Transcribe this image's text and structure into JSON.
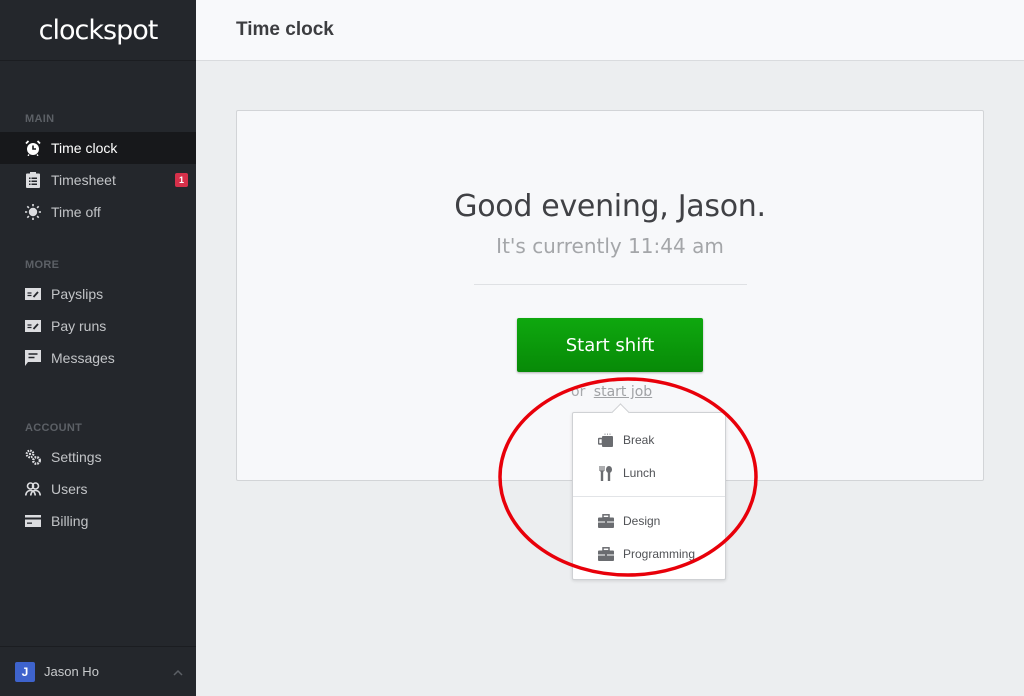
{
  "app": {
    "logo": "clockspot"
  },
  "sidebar": {
    "sections": [
      {
        "label": "MAIN",
        "items": [
          {
            "label": "Time clock",
            "icon": "alarm-clock-icon",
            "active": true
          },
          {
            "label": "Timesheet",
            "icon": "clipboard-list-icon",
            "badge": "1"
          },
          {
            "label": "Time off",
            "icon": "sun-icon"
          }
        ]
      },
      {
        "label": "MORE",
        "items": [
          {
            "label": "Payslips",
            "icon": "payslip-icon"
          },
          {
            "label": "Pay runs",
            "icon": "pay-run-icon"
          },
          {
            "label": "Messages",
            "icon": "chat-bubble-icon"
          }
        ]
      },
      {
        "label": "ACCOUNT",
        "items": [
          {
            "label": "Settings",
            "icon": "gears-icon"
          },
          {
            "label": "Users",
            "icon": "users-icon"
          },
          {
            "label": "Billing",
            "icon": "credit-card-icon"
          }
        ]
      }
    ],
    "user": {
      "initial": "J",
      "name": "Jason Ho",
      "avatar_color": "#3e63cc"
    }
  },
  "header": {
    "title": "Time clock"
  },
  "main": {
    "greeting": "Good evening, Jason.",
    "current_time": "It's currently 11:44 am",
    "start_shift_label": "Start shift",
    "or_text": "or",
    "start_job_label": "start job",
    "start_shift_color": "#0b9a0b"
  },
  "dropdown": {
    "breaks": [
      {
        "label": "Break",
        "icon": "coffee-mug-icon"
      },
      {
        "label": "Lunch",
        "icon": "fork-spoon-icon"
      }
    ],
    "jobs": [
      {
        "label": "Design",
        "icon": "briefcase-icon"
      },
      {
        "label": "Programming",
        "icon": "briefcase-icon"
      }
    ]
  },
  "annotation": {
    "color": "#e8000a"
  }
}
